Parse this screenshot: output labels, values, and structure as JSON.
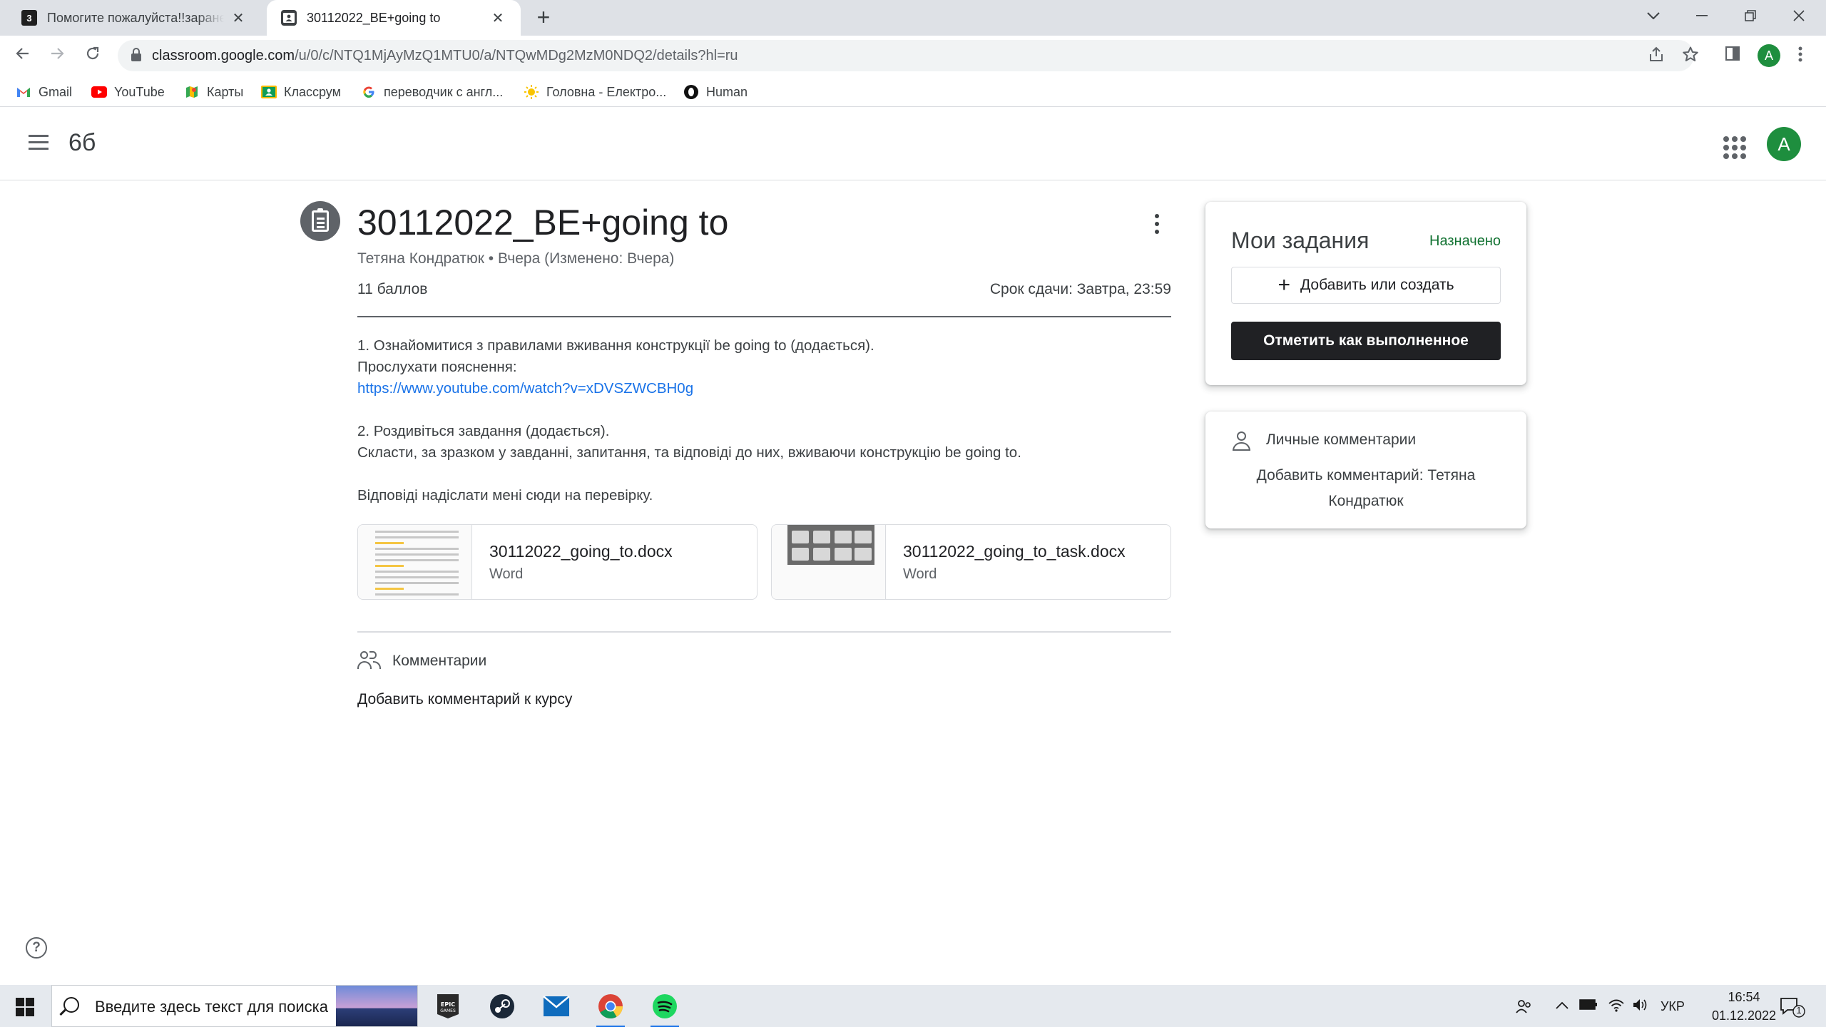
{
  "browser": {
    "tabs": [
      {
        "favicon": "3",
        "title": "Помогите пожалуйста!!заранее спасибо",
        "active": false
      },
      {
        "favicon": "classroom-icon",
        "title": "30112022_BE+going to",
        "active": true
      }
    ],
    "url_host": "classroom.google.com",
    "url_path": "/u/0/c/NTQ1MjAyMzQ1MTU0/a/NTQwMDg2MzM0NDQ2/details?hl=ru",
    "profile_initial": "A",
    "bookmarks": [
      {
        "label": "Gmail",
        "icon": "gmail-icon"
      },
      {
        "label": "YouTube",
        "icon": "youtube-icon"
      },
      {
        "label": "Карты",
        "icon": "maps-icon"
      },
      {
        "label": "Классрум",
        "icon": "classroom-icon"
      },
      {
        "label": "переводчик с англ...",
        "icon": "google-icon"
      },
      {
        "label": "Головна - Електро...",
        "icon": "sun-icon"
      },
      {
        "label": "Human",
        "icon": "human-icon"
      }
    ]
  },
  "classroom": {
    "class_name": "6б",
    "user_initial": "A"
  },
  "assignment": {
    "title": "30112022_BE+going to",
    "meta": "Тетяна Кондратюк • Вчера (Изменено: Вчера)",
    "points": "11 баллов",
    "due": "Срок сдачи: Завтра, 23:59",
    "description": {
      "line1": "1. Ознайомитися з правилами вживання конструкції be going to (додається).",
      "line2": "Прослухати пояснення:",
      "link": "https://www.youtube.com/watch?v=xDVSZWCBH0g",
      "line4": "2. Роздивіться завдання (додається).",
      "line5": "Скласти, за зразком у завданні, запитання, та відповіді до них, вживаючи конструкцію be going to.",
      "line7": "Відповіді надіслати мені сюди на перевірку."
    },
    "attachments": [
      {
        "name": "30112022_going_to.docx",
        "type": "Word"
      },
      {
        "name": "30112022_going_to_task.docx",
        "type": "Word"
      }
    ],
    "comments_label": "Комментарии",
    "add_class_comment": "Добавить комментарий к курсу"
  },
  "my_work": {
    "title": "Мои задания",
    "status": "Назначено",
    "status_color": "#137333",
    "add_button": "Добавить или создать",
    "mark_done_button": "Отметить как выполненное"
  },
  "private_comments": {
    "title": "Личные комментарии",
    "add_label": "Добавить комментарий: Тетяна Кондратюк"
  },
  "taskbar": {
    "search_placeholder": "Введите здесь текст для поиска",
    "language": "УКР",
    "time": "16:54",
    "date": "01.12.2022",
    "notification_count": "1",
    "apps": [
      "epic-games-icon",
      "steam-icon",
      "mail-icon",
      "chrome-icon",
      "spotify-icon"
    ]
  }
}
